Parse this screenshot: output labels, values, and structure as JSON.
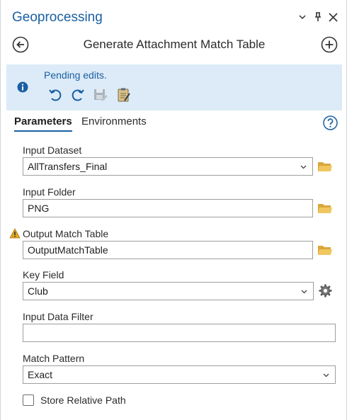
{
  "pane": {
    "title": "Geoprocessing"
  },
  "tool": {
    "title": "Generate Attachment Match Table"
  },
  "banner": {
    "message": "Pending edits."
  },
  "tabs": [
    {
      "label": "Parameters",
      "active": true
    },
    {
      "label": "Environments",
      "active": false
    }
  ],
  "params": {
    "input_dataset": {
      "label": "Input Dataset",
      "value": "AllTransfers_Final"
    },
    "input_folder": {
      "label": "Input Folder",
      "value": "PNG"
    },
    "output_match_table": {
      "label": "Output Match Table",
      "value": "OutputMatchTable"
    },
    "key_field": {
      "label": "Key Field",
      "value": "Club"
    },
    "input_data_filter": {
      "label": "Input Data Filter",
      "value": ""
    },
    "match_pattern": {
      "label": "Match Pattern",
      "value": "Exact"
    },
    "store_relative_path": {
      "label": "Store Relative Path",
      "checked": false
    }
  },
  "colors": {
    "accent": "#1a5fa3",
    "banner_bg": "#dcebf7",
    "folder": "#e8b84a",
    "warning": "#e0a526"
  },
  "icons": [
    "chevron-down-icon",
    "pin-icon",
    "close-icon",
    "back-icon",
    "add-icon",
    "info-icon",
    "undo-icon",
    "redo-icon",
    "save-edits-icon",
    "discard-edits-icon",
    "help-icon",
    "folder-icon",
    "warning-icon",
    "gear-icon"
  ]
}
